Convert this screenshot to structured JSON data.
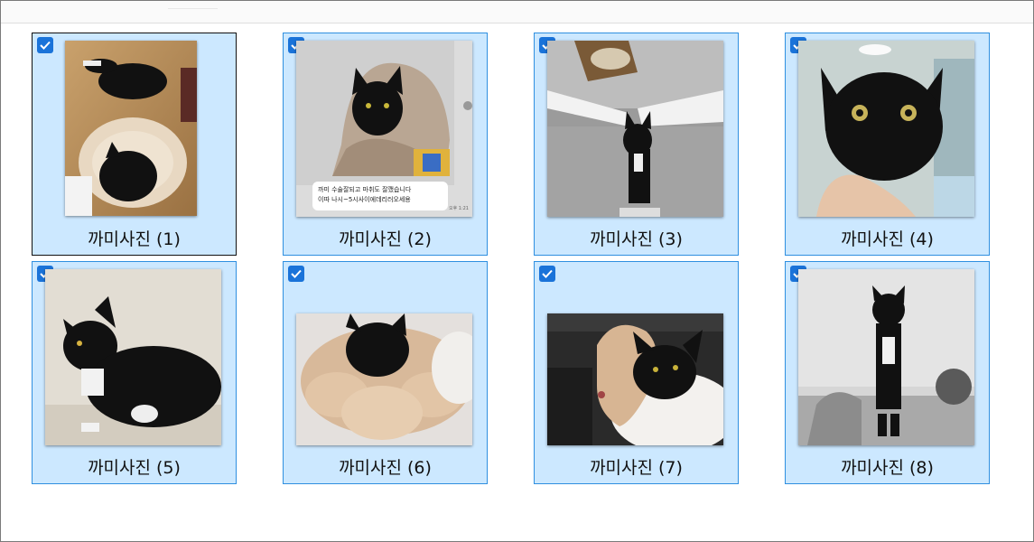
{
  "items": [
    {
      "name": "까미사진 (1)",
      "selected": true,
      "focused": true,
      "photo": "cat-lying-on-floor-with-cushion"
    },
    {
      "name": "까미사진 (2)",
      "selected": true,
      "focused": false,
      "photo": "cat-in-blanket-message-screenshot",
      "caption_lines": [
        "까미 수술잘되고 마취도 잘깼습니다",
        "이따 나시~5시사이에데리러오세용"
      ],
      "caption_time": "오후 1:21"
    },
    {
      "name": "까미사진 (3)",
      "selected": true,
      "focused": false,
      "photo": "cat-standing-on-shelf"
    },
    {
      "name": "까미사진 (4)",
      "selected": true,
      "focused": false,
      "photo": "cat-face-held-by-hand"
    },
    {
      "name": "까미사진 (5)",
      "selected": true,
      "focused": false,
      "photo": "cat-sitting-side-profile"
    },
    {
      "name": "까미사진 (6)",
      "selected": true,
      "focused": false,
      "photo": "cat-with-cone-collar"
    },
    {
      "name": "까미사진 (7)",
      "selected": true,
      "focused": false,
      "photo": "cat-with-collar-lying"
    },
    {
      "name": "까미사진 (8)",
      "selected": true,
      "focused": false,
      "photo": "cat-sitting-tuxedo"
    }
  ],
  "colors": {
    "selection_bg": "#cce8ff",
    "selection_border": "#2f8fe0",
    "checkbox": "#1a73d9"
  }
}
